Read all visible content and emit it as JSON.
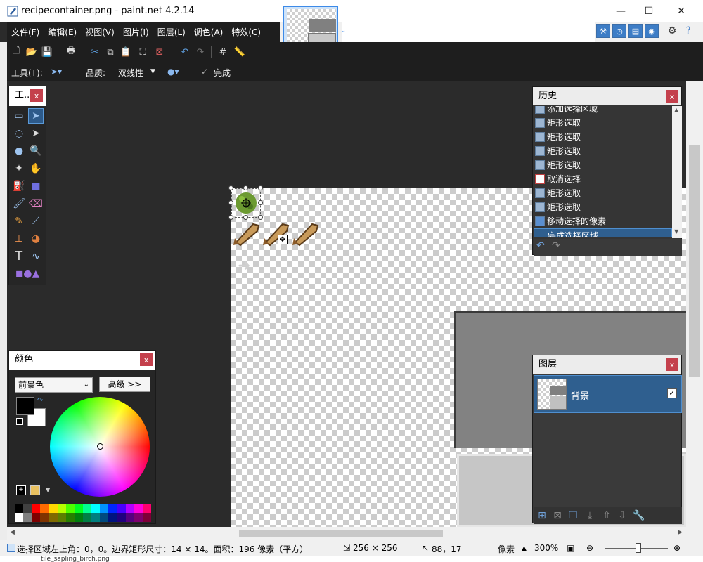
{
  "window": {
    "title": "recipecontainer.png - paint.net 4.2.14",
    "minimize": "—",
    "maximize": "☐",
    "close": "✕"
  },
  "menu": [
    "文件(F)",
    "编辑(E)",
    "视图(V)",
    "图片(I)",
    "图层(L)",
    "调色(A)",
    "特效(C)"
  ],
  "options": {
    "tool_label": "工具(T):",
    "quality_label": "品质:",
    "quality_value": "双线性",
    "finish_label": "完成"
  },
  "tools_panel": {
    "title": "工...",
    "close": "x"
  },
  "history_panel": {
    "title": "历史",
    "close": "x",
    "items": [
      {
        "label": "添加选择区域",
        "icon": "rect-select-icon"
      },
      {
        "label": "矩形选取",
        "icon": "rect-select-icon"
      },
      {
        "label": "矩形选取",
        "icon": "rect-select-icon"
      },
      {
        "label": "矩形选取",
        "icon": "rect-select-icon"
      },
      {
        "label": "矩形选取",
        "icon": "rect-select-icon"
      },
      {
        "label": "取消选择",
        "icon": "deselect-icon"
      },
      {
        "label": "矩形选取",
        "icon": "rect-select-icon"
      },
      {
        "label": "矩形选取",
        "icon": "rect-select-icon"
      },
      {
        "label": "移动选择的像素",
        "icon": "move-pixels-icon"
      },
      {
        "label": "完成选择区域",
        "icon": "finish-selection-icon",
        "active": true
      }
    ]
  },
  "colors_panel": {
    "title": "颜色",
    "close": "x",
    "mode": "前景色",
    "advanced": "高级 >>",
    "primary": "#000000",
    "secondary": "#ffffff",
    "palette": [
      "#000000",
      "#404040",
      "#ff0000",
      "#ff6a00",
      "#ffd800",
      "#b6ff00",
      "#4cff00",
      "#00ff21",
      "#00ff90",
      "#00ffff",
      "#0094ff",
      "#0026ff",
      "#4800ff",
      "#b200ff",
      "#ff00dc",
      "#ff006e",
      "#ffffff",
      "#808080",
      "#7f0000",
      "#7f3300",
      "#7f6a00",
      "#5b7f00",
      "#267f00",
      "#007f0e",
      "#007f46",
      "#007f7f",
      "#004a7f",
      "#00137f",
      "#21007f",
      "#57007f",
      "#7f006e",
      "#7f0037"
    ]
  },
  "layers_panel": {
    "title": "图层",
    "close": "x",
    "layer_name": "背景",
    "visible_check": "✓"
  },
  "status": {
    "selection_info": "选择区域左上角：0，0。边界矩形尺寸：14 × 14。面积：196 像素（平方）",
    "image_size": "256 × 256",
    "cursor_pos": "88，17",
    "units": "像素",
    "zoom": "300%"
  },
  "below_text": "tile_sapling_birch.png"
}
